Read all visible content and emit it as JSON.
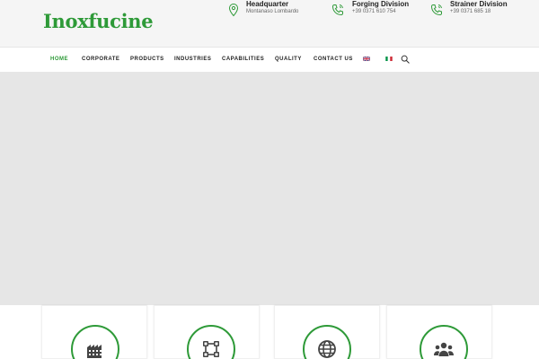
{
  "brand": {
    "logo_text": "Inoxfucine",
    "color": "#2e9a38"
  },
  "contacts": [
    {
      "title": "Headquarter",
      "sub": "Montanaso Lombardo",
      "icon": "location-pin-icon"
    },
    {
      "title": "Forging Division",
      "sub": "+39 0371 610 754",
      "icon": "phone-icon"
    },
    {
      "title": "Strainer Division",
      "sub": "+39 0371 685 18",
      "icon": "phone-icon"
    }
  ],
  "nav": {
    "items": [
      {
        "label": "HOME",
        "active": true
      },
      {
        "label": "CORPORATE"
      },
      {
        "label": "PRODUCTS"
      },
      {
        "label": "INDUSTRIES"
      },
      {
        "label": "CAPABILITIES"
      },
      {
        "label": "QUALITY"
      },
      {
        "label": "CONTACT US"
      }
    ],
    "languages": [
      "english-flag-icon",
      "italian-flag-icon"
    ],
    "search_icon": "search-icon"
  },
  "features": [
    {
      "icon": "factory-icon"
    },
    {
      "icon": "vector-shape-icon"
    },
    {
      "icon": "globe-icon"
    },
    {
      "icon": "users-icon"
    }
  ]
}
